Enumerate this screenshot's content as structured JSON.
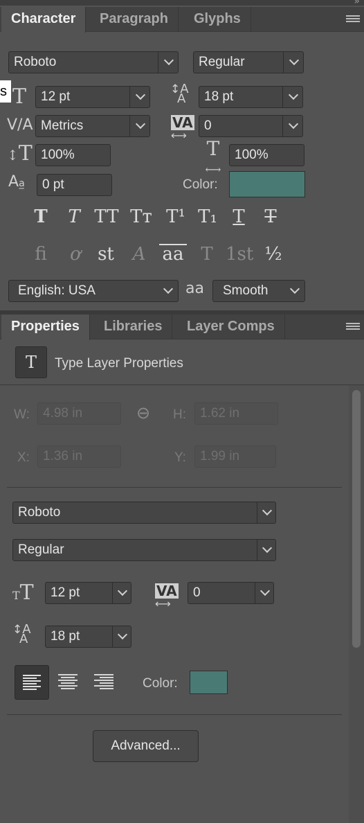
{
  "character_panel": {
    "tabs": [
      {
        "label": "Character",
        "active": true
      },
      {
        "label": "Paragraph",
        "active": false
      },
      {
        "label": "Glyphs",
        "active": false
      }
    ],
    "font_family": "Roboto",
    "font_style": "Regular",
    "tooltip_fragment": "s",
    "font_size": "12 pt",
    "leading": "18 pt",
    "kerning": "Metrics",
    "tracking": "0",
    "vertical_scale": "100%",
    "horizontal_scale": "100%",
    "baseline_shift": "0 pt",
    "color_label": "Color:",
    "color_value": "#4a7a74",
    "style_buttons": [
      "T",
      "T",
      "TT",
      "Tт",
      "T¹",
      "T₁",
      "T",
      "T"
    ],
    "opentype_buttons": [
      "ﬁ",
      "ơ",
      "st",
      "A",
      "aa",
      "T",
      "1st",
      "½"
    ],
    "language": "English: USA",
    "antialias_icon": "aa",
    "antialias": "Smooth"
  },
  "properties_panel": {
    "tabs": [
      {
        "label": "Properties",
        "active": true
      },
      {
        "label": "Libraries",
        "active": false
      },
      {
        "label": "Layer Comps",
        "active": false
      }
    ],
    "header_title": "Type Layer Properties",
    "w_label": "W:",
    "w_value": "4.98 in",
    "h_label": "H:",
    "h_value": "1.62 in",
    "x_label": "X:",
    "x_value": "1.36 in",
    "y_label": "Y:",
    "y_value": "1.99 in",
    "font_family": "Roboto",
    "font_style": "Regular",
    "font_size": "12 pt",
    "tracking": "0",
    "leading": "18 pt",
    "color_label": "Color:",
    "color_value": "#4a7a74",
    "advanced_button": "Advanced..."
  }
}
